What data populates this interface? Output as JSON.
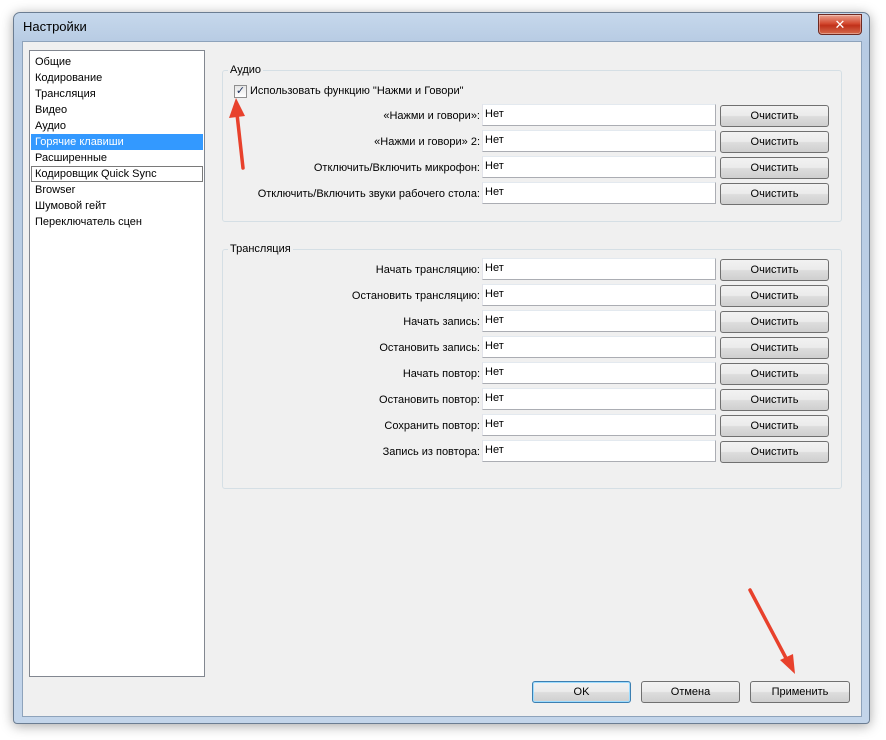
{
  "window": {
    "title": "Настройки",
    "close_symbol": "✕"
  },
  "nav": {
    "selected_index": 5,
    "items": [
      {
        "label": "Общие"
      },
      {
        "label": "Кодирование"
      },
      {
        "label": "Трансляция"
      },
      {
        "label": "Видео"
      },
      {
        "label": "Аудио"
      },
      {
        "label": "Горячие клавиши"
      },
      {
        "label": "Расширенные"
      },
      {
        "label": "Кодировщик Quick Sync"
      },
      {
        "label": "Browser"
      },
      {
        "label": "Шумовой гейт"
      },
      {
        "label": "Переключатель сцен"
      }
    ]
  },
  "audio": {
    "group_title": "Аудио",
    "ptt_checkbox_label": "Использовать функцию \"Нажми и Говори\"",
    "ptt_checked": true,
    "check_mark": "✓",
    "rows": [
      {
        "label": "«Нажми и говори»:",
        "value": "Нет",
        "clear": "Очистить"
      },
      {
        "label": "«Нажми и говори» 2:",
        "value": "Нет",
        "clear": "Очистить"
      },
      {
        "label": "Отключить/Включить микрофон:",
        "value": "Нет",
        "clear": "Очистить"
      },
      {
        "label": "Отключить/Включить звуки рабочего стола:",
        "value": "Нет",
        "clear": "Очистить"
      }
    ]
  },
  "broadcast": {
    "group_title": "Трансляция",
    "rows": [
      {
        "label": "Начать трансляцию:",
        "value": "Нет",
        "clear": "Очистить"
      },
      {
        "label": "Остановить трансляцию:",
        "value": "Нет",
        "clear": "Очистить"
      },
      {
        "label": "Начать запись:",
        "value": "Нет",
        "clear": "Очистить"
      },
      {
        "label": "Остановить запись:",
        "value": "Нет",
        "clear": "Очистить"
      },
      {
        "label": "Начать повтор:",
        "value": "Нет",
        "clear": "Очистить"
      },
      {
        "label": "Остановить повтор:",
        "value": "Нет",
        "clear": "Очистить"
      },
      {
        "label": "Сохранить повтор:",
        "value": "Нет",
        "clear": "Очистить"
      },
      {
        "label": "Запись из повтора:",
        "value": "Нет",
        "clear": "Очистить"
      }
    ]
  },
  "footer": {
    "ok": "OK",
    "cancel": "Отмена",
    "apply": "Применить"
  },
  "colors": {
    "selection": "#3399ff",
    "annotation_arrow": "#e8412c"
  }
}
